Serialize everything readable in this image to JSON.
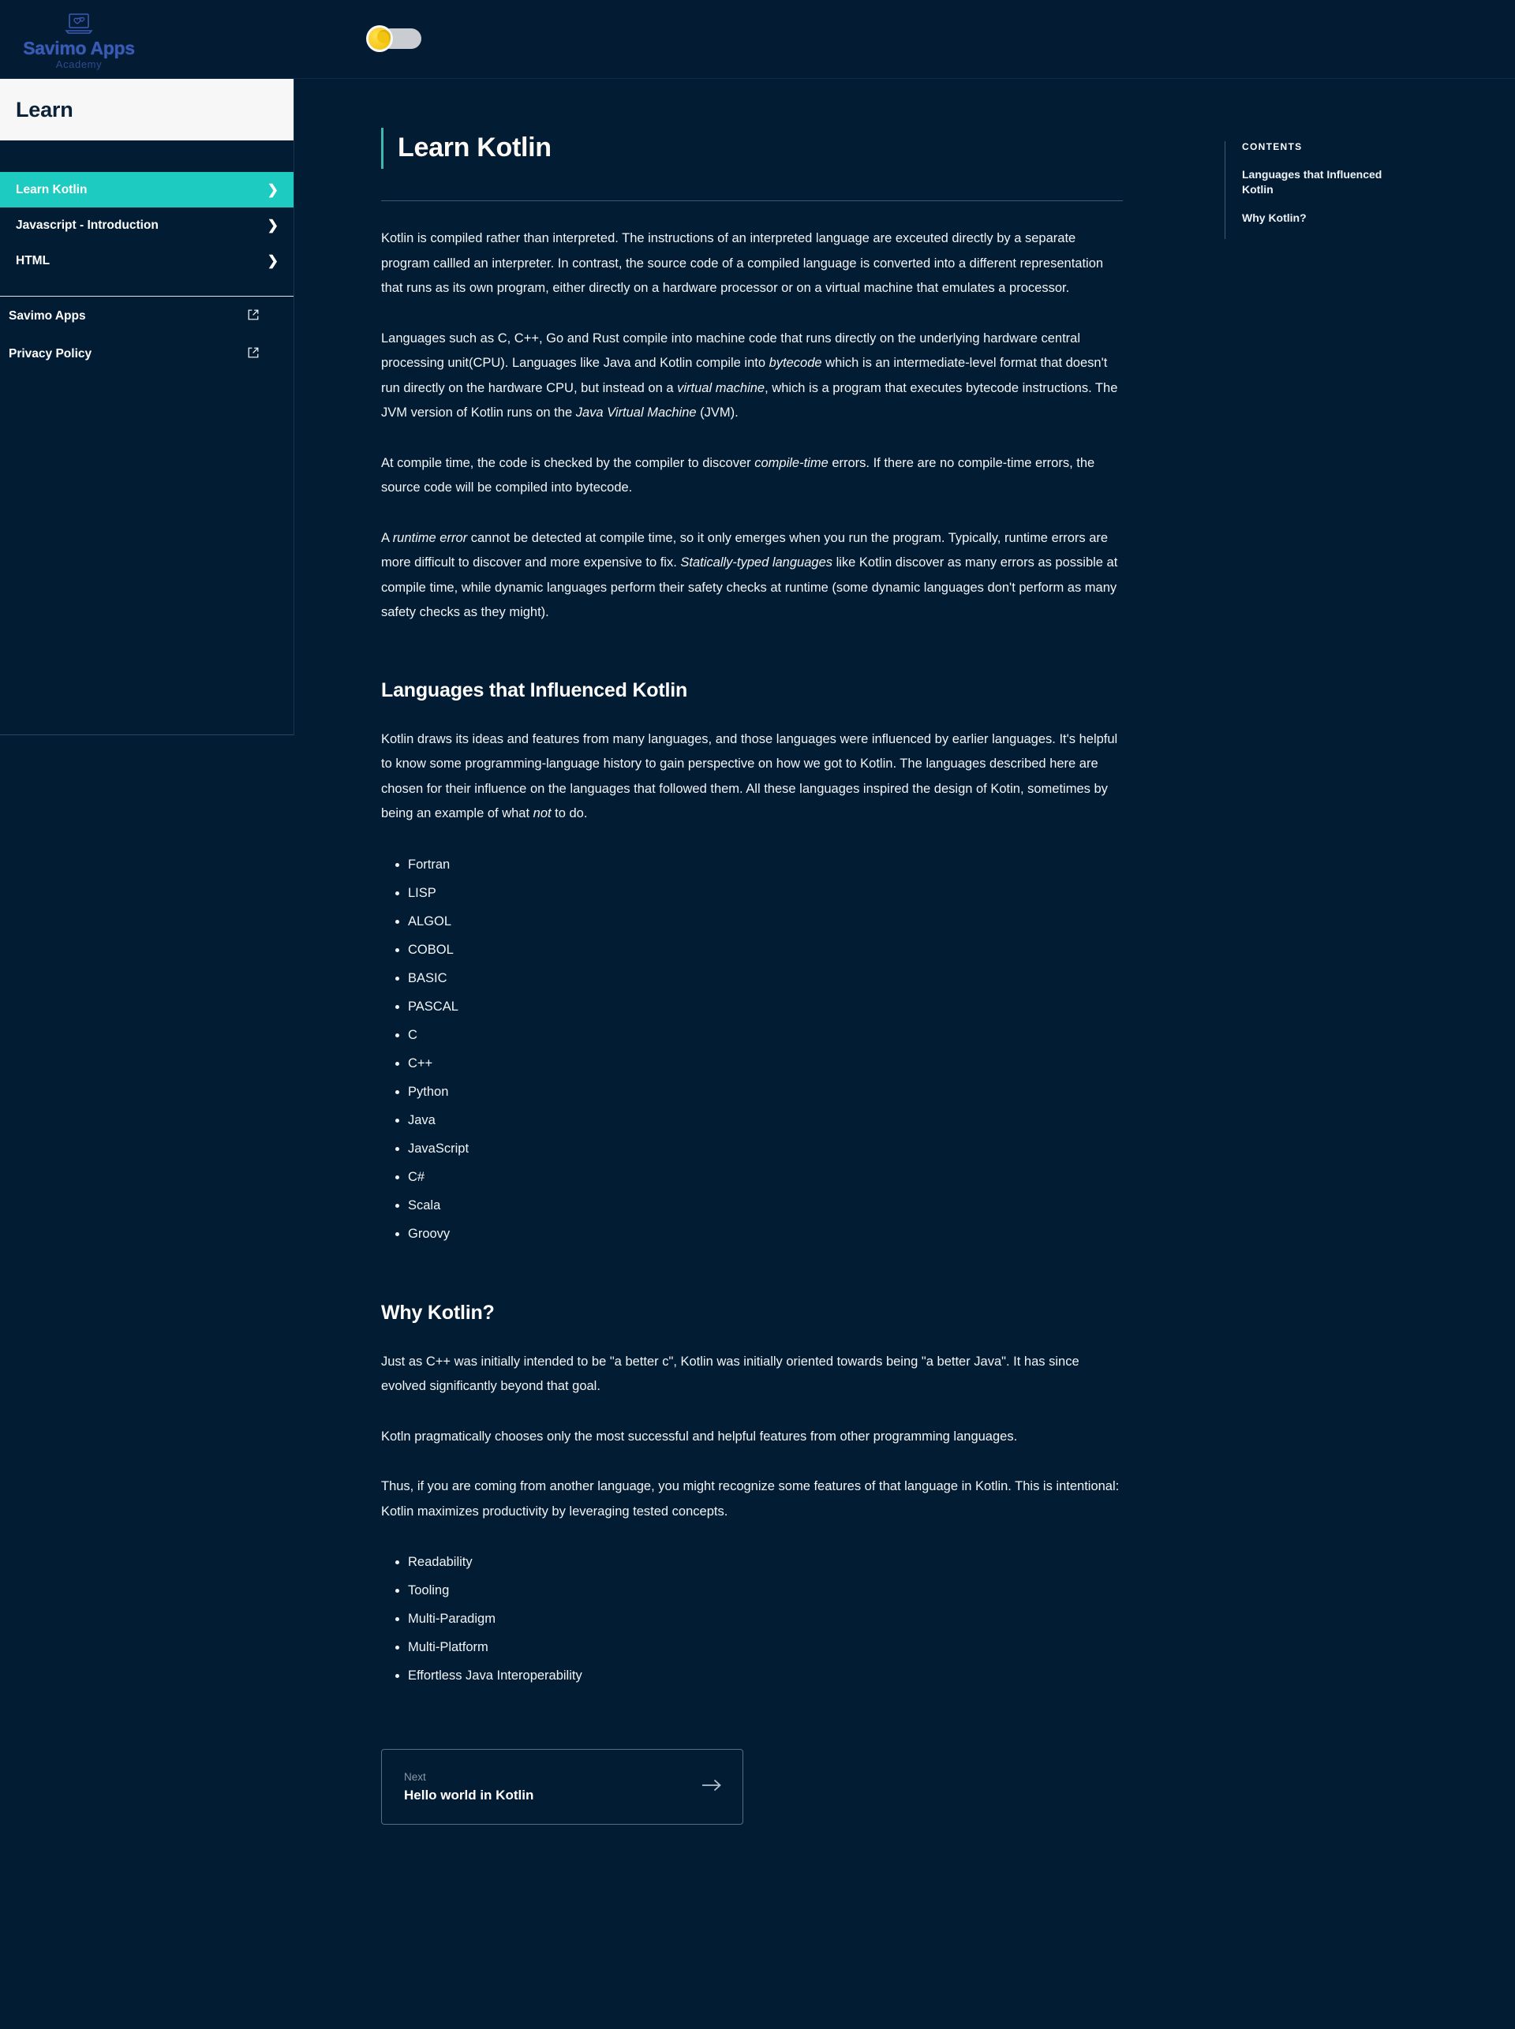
{
  "header": {
    "brand_name": "Savimo Apps",
    "brand_sub": "Academy",
    "logo_icon": "laptop-heart-icon",
    "theme_toggle": {
      "icon": "moon-icon",
      "state": "dark"
    }
  },
  "sidebar": {
    "title": "Learn",
    "items": [
      {
        "label": "Learn Kotlin",
        "active": true,
        "icon": "chevron-right-icon"
      },
      {
        "label": "Javascript - Introduction",
        "active": false,
        "icon": "chevron-right-icon"
      },
      {
        "label": "HTML",
        "active": false,
        "icon": "chevron-right-icon"
      }
    ],
    "external_links": [
      {
        "label": "Savimo Apps",
        "icon": "external-link-icon"
      },
      {
        "label": "Privacy Policy",
        "icon": "external-link-icon"
      }
    ]
  },
  "toc": {
    "heading": "CONTENTS",
    "links": [
      "Languages that Influenced Kotlin",
      "Why Kotlin?"
    ]
  },
  "article": {
    "title": "Learn Kotlin",
    "paragraphs": {
      "p1": "Kotlin is compiled rather than interpreted. The instructions of an interpreted language are exceuted directly by a separate program callled an interpreter. In contrast, the source code of a compiled language is converted into a different representation that runs as its own program, either directly on a hardware processor or on a virtual machine that emulates a processor.",
      "p2_a": "Languages such as C, C++, Go and Rust compile into machine code that runs directly on the underlying hardware central processing unit(CPU). Languages like Java and Kotlin compile into ",
      "p2_em1": "bytecode",
      "p2_b": " which is an intermediate-level format that doesn't run directly on the hardware CPU, but instead on a ",
      "p2_em2": "virtual machine",
      "p2_c": ", which is a program that executes bytecode instructions. The JVM version of Kotlin runs on the ",
      "p2_em3": "Java Virtual Machine",
      "p2_d": " (JVM).",
      "p3_a": "At compile time, the code is checked by the compiler to discover ",
      "p3_em1": "compile-time",
      "p3_b": " errors. If there are no compile-time errors, the source code will be compiled into bytecode.",
      "p4_a": "A ",
      "p4_em1": "runtime error",
      "p4_b": " cannot be detected at compile time, so it only emerges when you run the program. Typically, runtime errors are more difficult to discover and more expensive to fix. ",
      "p4_em2": "Statically-typed languages",
      "p4_c": " like Kotlin discover as many errors as possible at compile time, while dynamic languages perform their safety checks at runtime (some dynamic languages don't perform as many safety checks as they might)."
    },
    "sections": [
      {
        "heading": "Languages that Influenced Kotlin",
        "intro_a": "Kotlin draws its ideas and features from many languages, and those languages were influenced by earlier languages. It's helpful to know some programming-language history to gain perspective on how we got to Kotlin. The languages described here are chosen for their influence on the languages that followed them. All these languages inspired the design of Kotin, sometimes by being an example of what ",
        "intro_em": "not",
        "intro_b": " to do.",
        "list": [
          "Fortran",
          "LISP",
          "ALGOL",
          "COBOL",
          "BASIC",
          "PASCAL",
          "C",
          "C++",
          "Python",
          "Java",
          "JavaScript",
          "C#",
          "Scala",
          "Groovy"
        ]
      },
      {
        "heading": "Why Kotlin?",
        "p1": "Just as C++ was initially intended to be \"a better c\", Kotlin was initially oriented towards being \"a better Java\". It has since evolved significantly beyond that goal.",
        "p2": "Kotln pragmatically chooses only the most successful and helpful features from other programming languages.",
        "p3": "Thus, if you are coming from another language, you might recognize some features of that language in Kotlin. This is intentional: Kotlin maximizes productivity by leveraging tested concepts.",
        "list": [
          "Readability",
          "Tooling",
          "Multi-Paradigm",
          "Multi-Platform",
          "Effortless Java Interoperability"
        ]
      }
    ],
    "next_card": {
      "label": "Next",
      "title": "Hello world in Kotlin",
      "icon": "arrow-right-icon"
    }
  },
  "colors": {
    "background": "#021c33",
    "accent_teal": "#1ecbc0",
    "title_accent": "#3fb8ad",
    "brand_blue": "#3a5bb5",
    "sidebar_header_bg": "#f7f7f7",
    "moon_yellow": "#f5c518"
  }
}
